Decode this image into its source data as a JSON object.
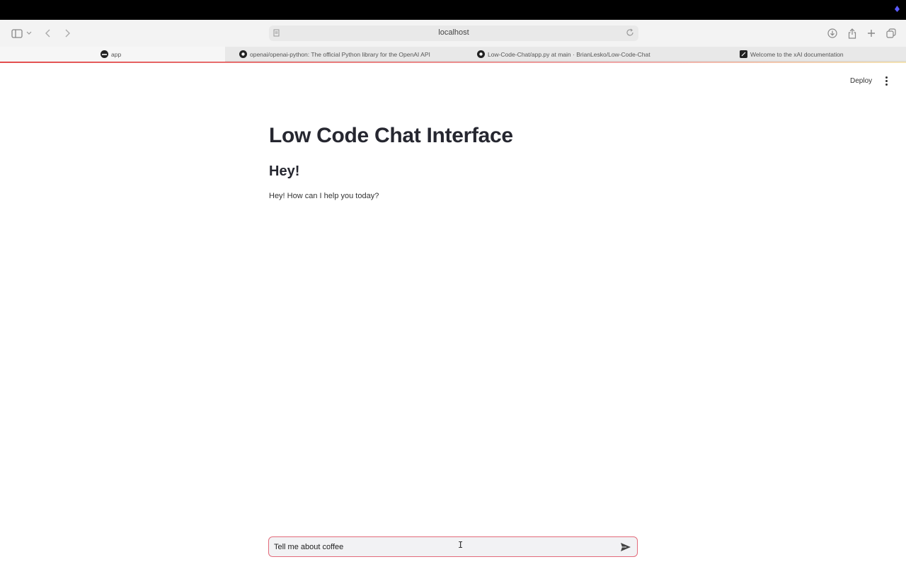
{
  "browser": {
    "url": "localhost",
    "tabs": [
      {
        "title": "app",
        "active": true
      },
      {
        "title": "openai/openai-python: The official Python library for the OpenAI API",
        "active": false
      },
      {
        "title": "Low-Code-Chat/app.py at main · BrianLesko/Low-Code-Chat",
        "active": false
      },
      {
        "title": "Welcome to the xAI documentation",
        "active": false
      }
    ]
  },
  "header": {
    "deploy_label": "Deploy"
  },
  "main": {
    "title": "Low Code Chat Interface",
    "subheading": "Hey!",
    "message": "Hey! How can I help you today?"
  },
  "chat_input": {
    "value": "Tell me about coffee"
  },
  "colors": {
    "accent": "#e36a7a",
    "text": "#262730"
  }
}
